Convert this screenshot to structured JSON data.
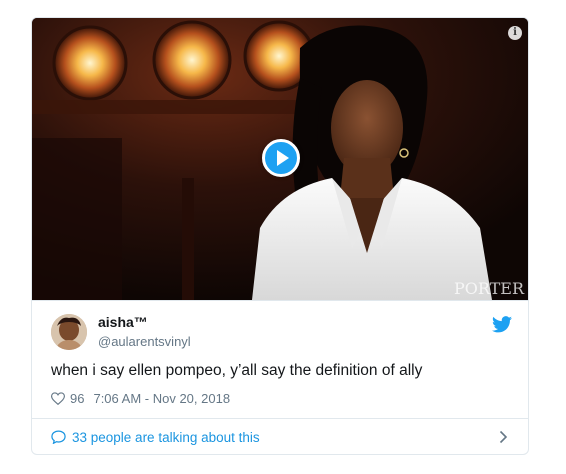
{
  "video": {
    "watermark": "PORTER",
    "info_icon": "info-icon",
    "play_icon": "play-icon"
  },
  "user": {
    "display_name": "aisha™",
    "handle": "@aularentsvinyl"
  },
  "tweet": {
    "text": "when i say ellen pompeo, y’all say the definition of ally",
    "like_count": "96",
    "timestamp": "7:06 AM - Nov 20, 2018"
  },
  "footer": {
    "conversation_text": "33 people are talking about this"
  },
  "colors": {
    "twitter_blue": "#1da1f2",
    "link_blue": "#1b95e0",
    "text_primary": "#14171a",
    "text_secondary": "#657786",
    "border": "#e1e8ed"
  },
  "icons": [
    "info-icon",
    "play-icon",
    "twitter-bird-icon",
    "heart-icon",
    "conversation-icon",
    "chevron-right-icon"
  ]
}
